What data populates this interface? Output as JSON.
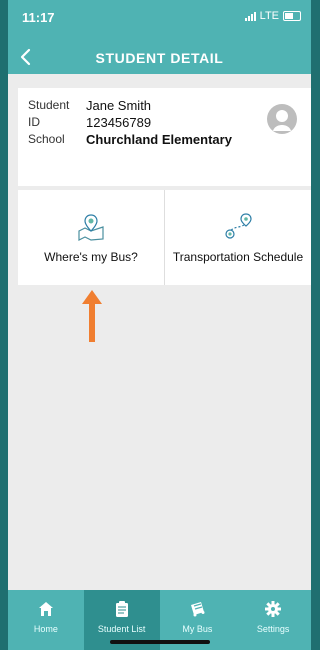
{
  "status_bar": {
    "time": "11:17",
    "network": "LTE"
  },
  "header": {
    "title": "STUDENT DETAIL"
  },
  "student": {
    "labels": {
      "student": "Student",
      "id": "ID",
      "school": "School"
    },
    "name": "Jane Smith",
    "id": "123456789",
    "school": "Churchland Elementary"
  },
  "actions": [
    {
      "label": "Where's my Bus?",
      "icon": "map-pin-icon"
    },
    {
      "label": "Transportation Schedule",
      "icon": "route-icon"
    }
  ],
  "tabs": [
    {
      "label": "Home",
      "icon": "home-icon",
      "active": false
    },
    {
      "label": "Student List",
      "icon": "clipboard-icon",
      "active": true
    },
    {
      "label": "My Bus",
      "icon": "bus-icon",
      "active": false
    },
    {
      "label": "Settings",
      "icon": "gear-icon",
      "active": false
    }
  ],
  "colors": {
    "primary": "#4fb3b3",
    "active_tab": "#2f8f8f",
    "accent_arrow": "#f07e30"
  }
}
